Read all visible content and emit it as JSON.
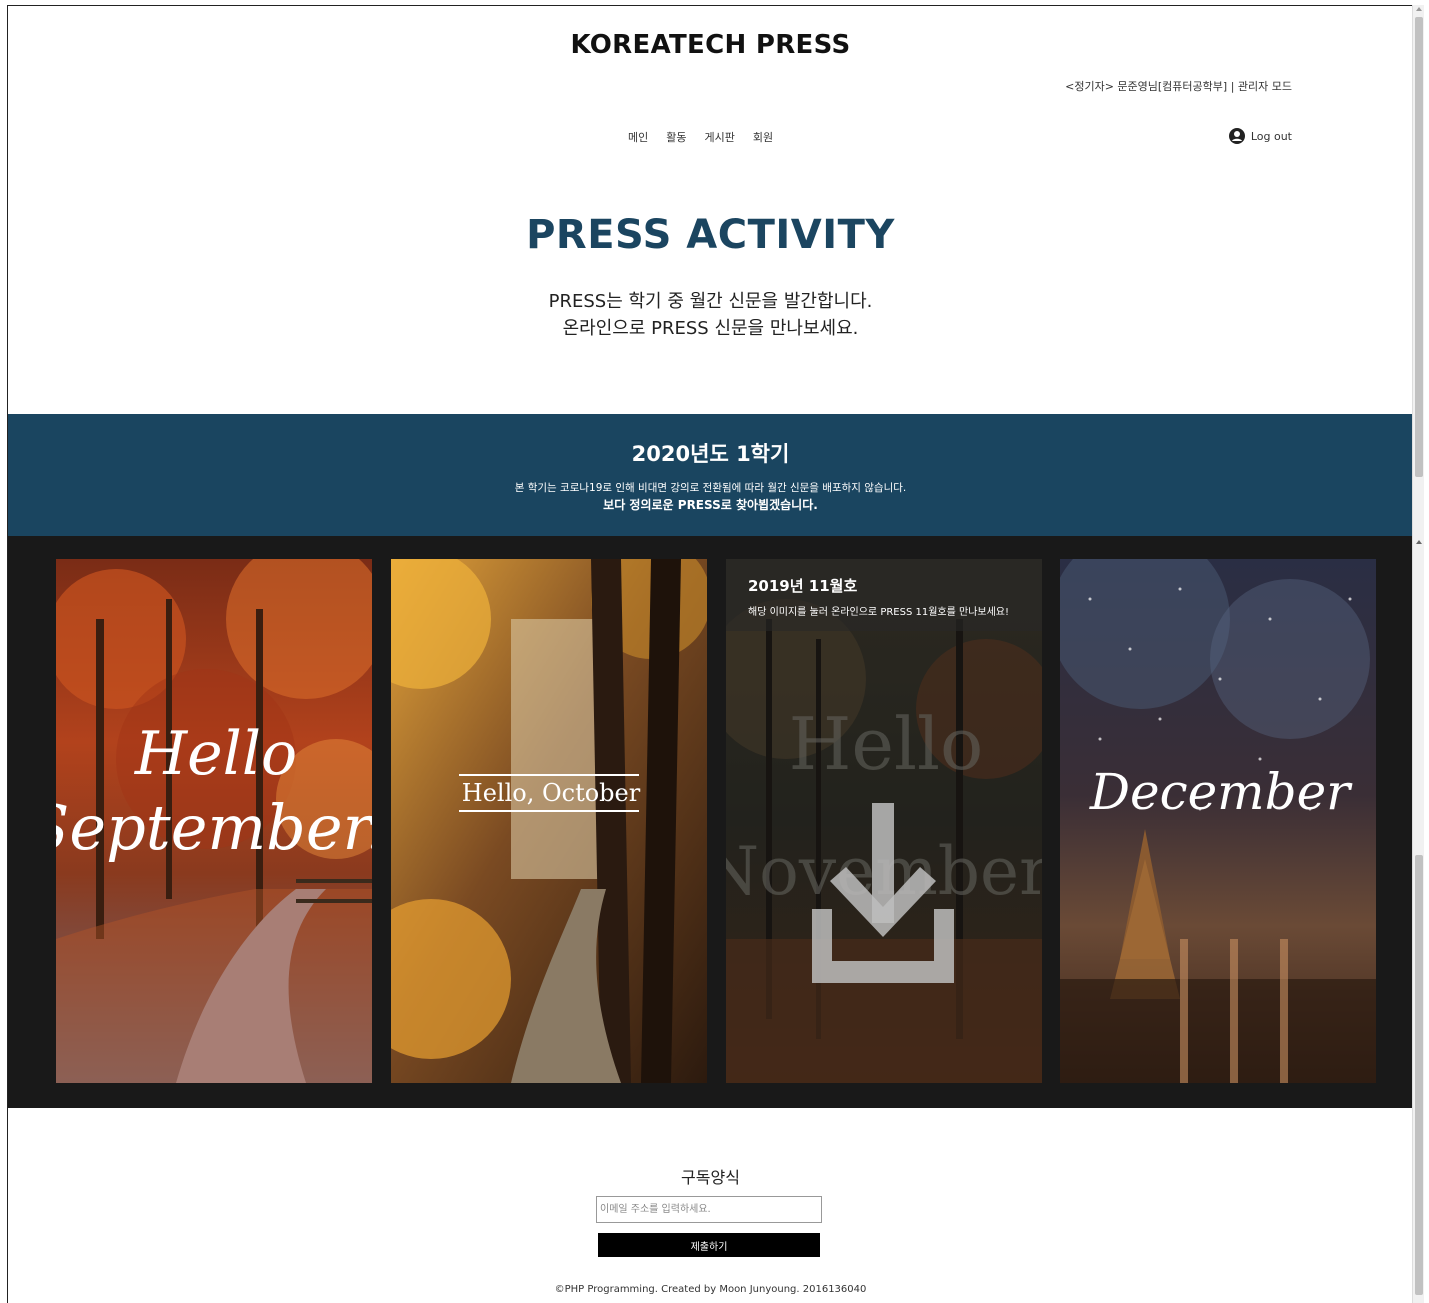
{
  "header": {
    "site_title": "KOREATECH PRESS",
    "user_info": "<정기자> 문준영님[컴퓨터공학부] | 관리자 모드",
    "nav": [
      "메인",
      "활동",
      "게시판",
      "회원"
    ],
    "logout_label": "Log out"
  },
  "activity": {
    "title": "PRESS ACTIVITY",
    "desc_line1": "PRESS는 학기 중 월간 신문을 발간합니다.",
    "desc_line2": "온라인으로 PRESS 신문을 만나보세요."
  },
  "semester": {
    "title": "2020년도 1학기",
    "note1": "본 학기는 코로나19로 인해 비대면 강의로 전환됨에 따라 월간 신문을 배포하지 않습니다.",
    "note2": "보다 정의로운 PRESS로 찾아뵙겠습니다."
  },
  "gallery": {
    "cards": [
      {
        "script_text_1": "Hello",
        "script_text_2": "September."
      },
      {
        "script_text": "Hello, October"
      },
      {
        "overlay_title": "2019년 11월호",
        "overlay_desc": "해당 이미지를 눌러 온라인으로 PRESS 11월호를 만나보세요!",
        "bg_text_1": "Hello",
        "bg_text_2": "November"
      },
      {
        "script_text": "December"
      }
    ]
  },
  "subscribe": {
    "title": "구독양식",
    "placeholder": "이메일 주소를 입력하세요.",
    "submit_label": "제출하기"
  },
  "footer": {
    "text": "©PHP Programming. Created by Moon Junyoung. 2016136040"
  },
  "colors": {
    "brand_blue": "#1a4560",
    "gallery_bg": "#191919"
  },
  "icons": {
    "user": "user-circle-icon",
    "download": "download-icon"
  }
}
